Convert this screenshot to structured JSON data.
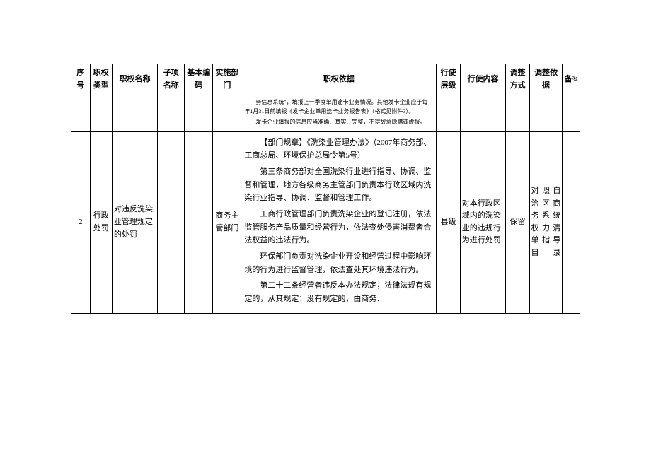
{
  "headers": {
    "xuhao": "序号",
    "leixing": "职权类型",
    "mingcheng": "职权名称",
    "zixiang": "子项名称",
    "bianma": "基本编码",
    "bumen": "实施部门",
    "yiju": "职权依据",
    "cengji": "行使层级",
    "neirong": "行使内容",
    "fangshi": "调整方式",
    "tiaozheng": "调整依据",
    "beizhu": "备¾"
  },
  "row1": {
    "yiju_p1": "务信息系统\"，填报上一季度单用途卡业务情况。其他发卡企业应于每年1月31日前填报《发卡企业单用途卡业务报告表》（格式见附件3）。",
    "yiju_p2": "发卡企业填报的信息应当准确、真实、完整，不得故意隐瞒或虚报。"
  },
  "row2": {
    "xuhao": "2",
    "leixing": "行政处罚",
    "mingcheng": "对违反洗染业管理规定的处罚",
    "bumen": "商务主管部门",
    "yiju_p1": "【部门规章】《洗染业管理办法》（2007年商务部、工商总局、环境保护总局令第5号）",
    "yiju_p2": "第三条商务部对全国洗染行业进行指导、协调、监督和管理，地方各级商务主管部门负责本行政区域内洗染行业指导、协调、监督和管理工作。",
    "yiju_p3": "工商行政管理部门负责洗染企业的登记注册，依法监管服务产品质量和经营行为，依法查处侵害消费者合法权益的违法行为。",
    "yiju_p4": "环保部门负责对洗染企业开设和经营过程中影响环境的行为进行监督管理，依法查处其环境违法行为。",
    "yiju_p5": "第二十二条经营者违反本办法规定，法律法规有规定的，从其规定；没有规定的，由商务、",
    "cengji": "县级",
    "neirong": "对本行政区域内的洗染业的违规行为进行处罚",
    "fangshi": "保留",
    "tiaozheng": "对照自治区商务系统权力清单指导目录"
  }
}
